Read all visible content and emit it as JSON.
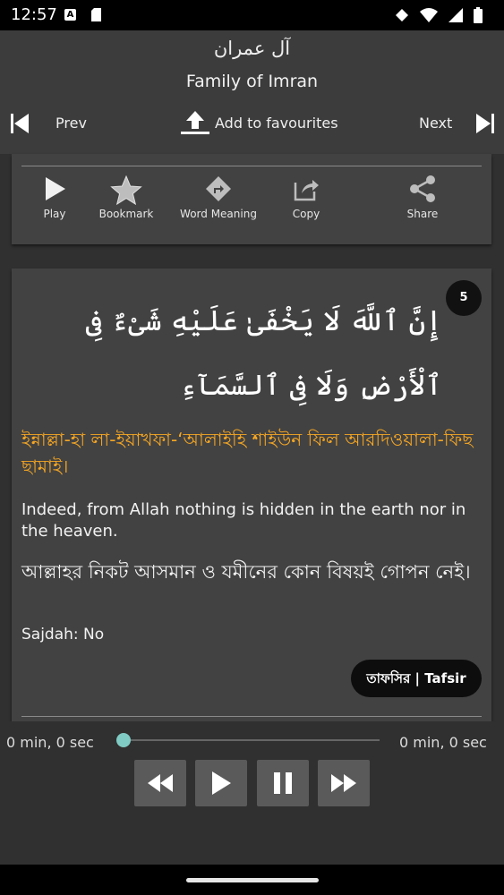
{
  "status_bar": {
    "time": "12:57"
  },
  "header": {
    "surah_arabic": "آل عمران",
    "surah_english": "Family of Imran",
    "prev_label": "Prev",
    "favourite_label": "Add to favourites",
    "next_label": "Next"
  },
  "actions": [
    {
      "label": "Play",
      "icon": "play-icon"
    },
    {
      "label": "Bookmark",
      "icon": "star-icon"
    },
    {
      "label": "Word Meaning",
      "icon": "turn-right-icon"
    },
    {
      "label": "Copy",
      "icon": "share-external-icon"
    },
    {
      "label": "Share",
      "icon": "share-icon"
    }
  ],
  "verse": {
    "number": "5",
    "arabic": "إِنَّ ٱللَّهَ لَا يَخْفَىٰ عَلَيْهِ شَىْءٌ فِى ٱلْأَرْضِ وَلَا فِى ٱلسَّمَآءِ",
    "transliteration": "ইন্নাল্লা-হা লা-ইয়াখফা-‘আলাইহি শাইউন ফিল আরদিওয়ালা-ফিছ ছামাই।",
    "translation_en": "Indeed, from Allah nothing is hidden in the earth nor in the heaven.",
    "translation_bn": "আল্লাহর নিকট আসমান ও যমীনের কোন বিষয়ই গোপন নেই।",
    "sajdah": "Sajdah: No",
    "tafsir_label": "তাফসির | Tafsir"
  },
  "player": {
    "elapsed": "0 min, 0 sec",
    "duration": "0 min, 0 sec",
    "progress": 0
  },
  "colors": {
    "accent_transliteration": "#f5a623",
    "seek_thumb": "#80cbc4",
    "card_background": "#424242",
    "header_background": "#3c3c3c"
  }
}
